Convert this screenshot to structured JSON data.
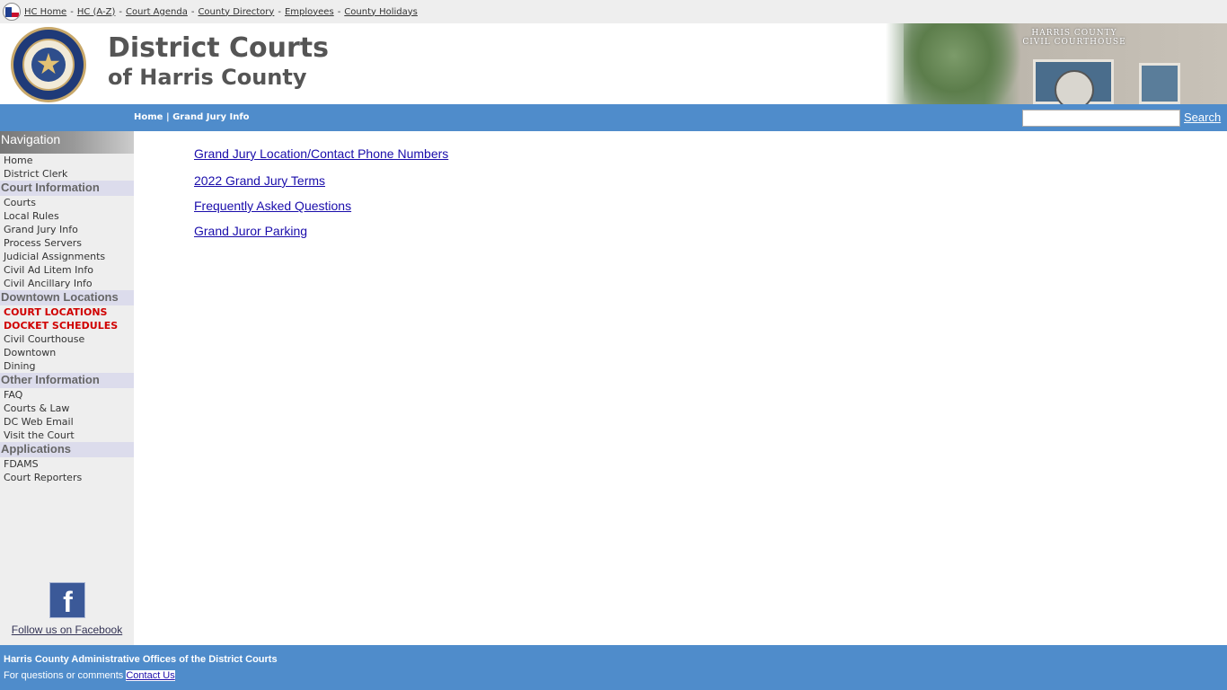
{
  "topbar": {
    "links": [
      "HC Home",
      "HC (A-Z)",
      "Court Agenda",
      "County Directory",
      "Employees",
      "County Holidays"
    ],
    "separator": "-"
  },
  "header": {
    "title_line1": "District Courts",
    "title_line2": "of Harris County",
    "photo_caption_1": "HARRIS COUNTY",
    "photo_caption_2": "CIVIL COURTHOUSE"
  },
  "navbar": {
    "breadcrumb_home": "Home",
    "breadcrumb_sep": "|",
    "breadcrumb_current": "Grand Jury Info",
    "search_placeholder": "",
    "search_label": "Search"
  },
  "sidebar": {
    "heading": "Navigation",
    "top_items": [
      "Home",
      "District Clerk"
    ],
    "sections": [
      {
        "title": "Court Information",
        "items": [
          "Courts",
          "Local Rules",
          "Grand Jury Info",
          "Process Servers",
          "Judicial Assignments",
          "Civil Ad Litem Info",
          "Civil Ancillary Info"
        ]
      },
      {
        "title": "Downtown Locations",
        "items": [
          "COURT LOCATIONS",
          "DOCKET SCHEDULES",
          "Civil Courthouse",
          "Downtown",
          "Dining"
        ]
      },
      {
        "title": "Other Information",
        "items": [
          "FAQ",
          "Courts & Law",
          "DC Web Email",
          "Visit the Court"
        ]
      },
      {
        "title": "Applications",
        "items": [
          "FDAMS",
          "Court Reporters"
        ]
      }
    ],
    "facebook_label": "Follow us on Facebook"
  },
  "main": {
    "links": [
      "Grand Jury Location/Contact Phone Numbers",
      "2022 Grand Jury Terms",
      "Frequently Asked Questions",
      "Grand Juror Parking"
    ]
  },
  "footer": {
    "line1": "Harris County Administrative Offices of the District Courts",
    "line2_prefix": "For questions or comments",
    "contact_label": "Contact Us"
  },
  "colors": {
    "nav_blue": "#4f8ccb",
    "alert_red": "#d00000",
    "link_blue": "#1a0dab"
  }
}
